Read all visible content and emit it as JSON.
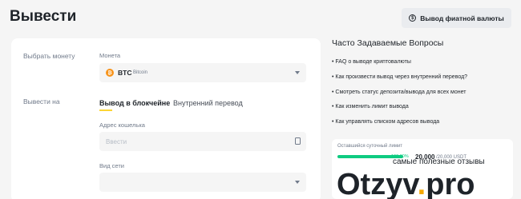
{
  "header": {
    "title": "Вывести",
    "fiat_button": "Вывод фиатной валюты"
  },
  "form": {
    "coin_section_label": "Выбрать монету",
    "coin_field_label": "Монета",
    "coin_symbol": "BTC",
    "coin_name": "Bitcoin",
    "withdraw_to_label": "Вывести на",
    "tabs": [
      {
        "label": "Вывод в блокчейне",
        "active": true
      },
      {
        "label": "Внутренний перевод",
        "active": false
      }
    ],
    "address_label": "Адрес кошелька",
    "address_placeholder": "Ввести",
    "network_label": "Вид сети"
  },
  "faq": {
    "title": "Часто Задаваемые Вопросы",
    "items": [
      "FAQ о выводе криптовалюты",
      "Как произвести вывод через внутренний перевод?",
      "Смотреть статус депозита/вывода для всех монет",
      "Как изменить лимит вывода",
      "Как управлять списком адресов вывода"
    ]
  },
  "limit": {
    "label": "Оставшийся суточный лимит",
    "percent": "100.00%",
    "fill_fraction": 1.0,
    "value": "20,000",
    "total": "/20,000 USDT"
  },
  "watermark": {
    "text": "самые полезные отзывы",
    "logo_main": "Otzyv",
    "logo_dot": ".",
    "logo_tld": "pro"
  },
  "colors": {
    "accent": "#fcd535",
    "btc": "#f7931a",
    "success": "#0ecb81"
  },
  "icons": [
    "currency-icon",
    "bitcoin-coin-icon",
    "chevron-down-icon",
    "paste-icon"
  ]
}
